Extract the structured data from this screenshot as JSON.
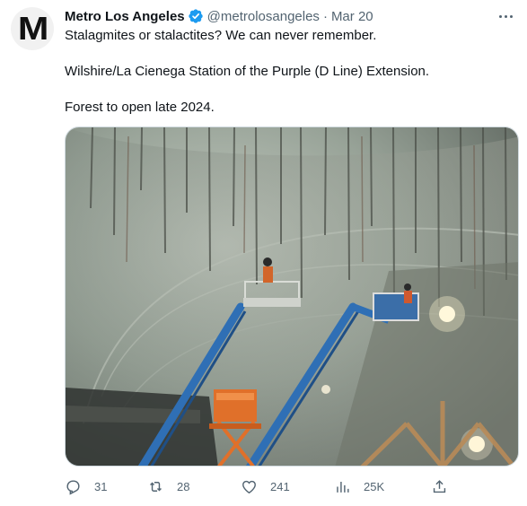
{
  "tweet": {
    "avatar_letter": "M",
    "author_name": "Metro Los Angeles",
    "verified": true,
    "handle": "@metrolosangeles",
    "separator": "·",
    "date": "Mar 20",
    "lines": [
      "Stalagmites or stalactites? We can never remember.",
      "Wilshire/La Cienega Station of the Purple (D Line) Extension.",
      "Forest to open late 2024."
    ],
    "media": {
      "kind": "photo",
      "colors": {
        "concrete": "#8f9a8f",
        "lift_boom": "#2f6fb5",
        "lift_orange": "#e0702a"
      }
    }
  },
  "actions": {
    "replies": "31",
    "retweets": "28",
    "likes": "241",
    "views": "25K"
  },
  "colors": {
    "verified": "#1d9bf0",
    "secondary_text": "#536471",
    "border": "#cfd9de"
  }
}
